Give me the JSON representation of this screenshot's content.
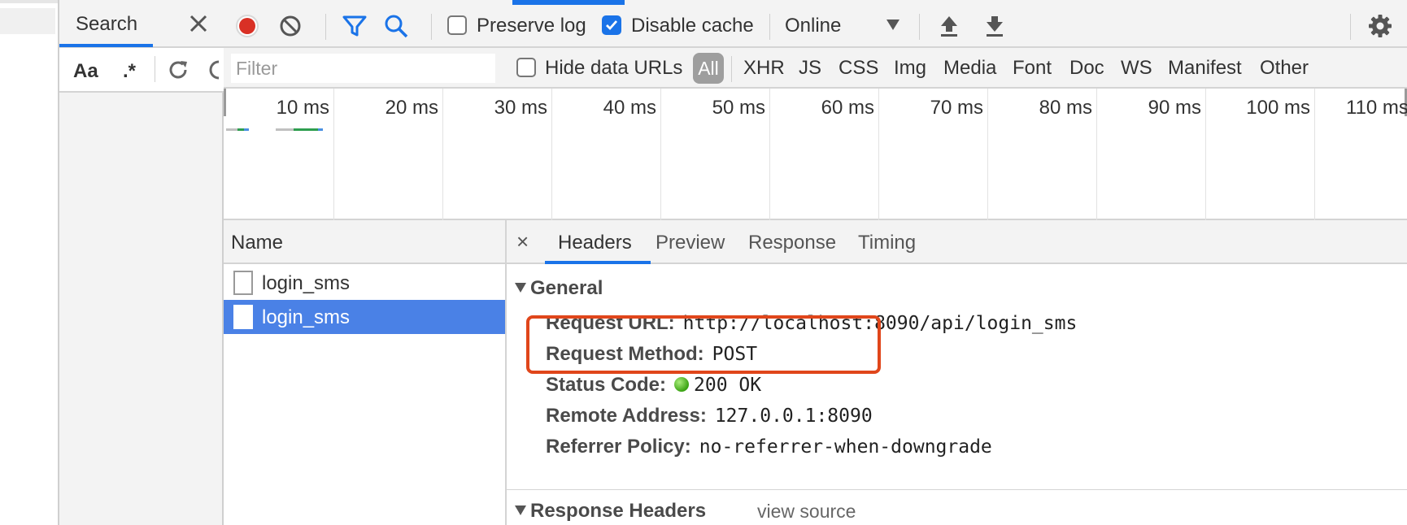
{
  "search_pane": {
    "tab_label": "Search",
    "match_case_label": "Aa",
    "regex_label": ".*"
  },
  "toolbar": {
    "preserve_log_label": "Preserve log",
    "preserve_log_checked": false,
    "disable_cache_label": "Disable cache",
    "disable_cache_checked": true,
    "throttling_value": "Online"
  },
  "filter_bar": {
    "filter_placeholder": "Filter",
    "hide_data_urls_label": "Hide data URLs",
    "resource_types": [
      "All",
      "XHR",
      "JS",
      "CSS",
      "Img",
      "Media",
      "Font",
      "Doc",
      "WS",
      "Manifest",
      "Other"
    ],
    "selected_type": "All"
  },
  "overview": {
    "tick_labels": [
      "10 ms",
      "20 ms",
      "30 ms",
      "40 ms",
      "50 ms",
      "60 ms",
      "70 ms",
      "80 ms",
      "90 ms",
      "100 ms",
      "110 ms"
    ]
  },
  "requests": {
    "column_header": "Name",
    "rows": [
      {
        "name": "login_sms",
        "selected": false
      },
      {
        "name": "login_sms",
        "selected": true
      }
    ]
  },
  "details": {
    "close_glyph": "×",
    "tabs": [
      "Headers",
      "Preview",
      "Response",
      "Timing"
    ],
    "active_tab": "Headers",
    "general": {
      "title": "General",
      "fields": [
        {
          "key": "Request URL:",
          "value": "http://localhost:8090/api/login_sms"
        },
        {
          "key": "Request Method:",
          "value": "POST"
        },
        {
          "key": "Status Code:",
          "value": "200 OK"
        },
        {
          "key": "Remote Address:",
          "value": "127.0.0.1:8090"
        },
        {
          "key": "Referrer Policy:",
          "value": "no-referrer-when-downgrade"
        }
      ]
    },
    "response_headers": {
      "title": "Response Headers",
      "view_source_label": "view source"
    }
  },
  "colors": {
    "accent": "#1a73e8",
    "record": "#d93025",
    "highlight": "#e0461b",
    "selected_row": "#4a81e6",
    "status_ok": "#3aa313"
  },
  "icons": [
    "close-icon",
    "record-icon",
    "clear-icon",
    "filter-icon",
    "search-icon",
    "upload-icon",
    "download-icon",
    "gear-icon",
    "refresh-icon"
  ]
}
